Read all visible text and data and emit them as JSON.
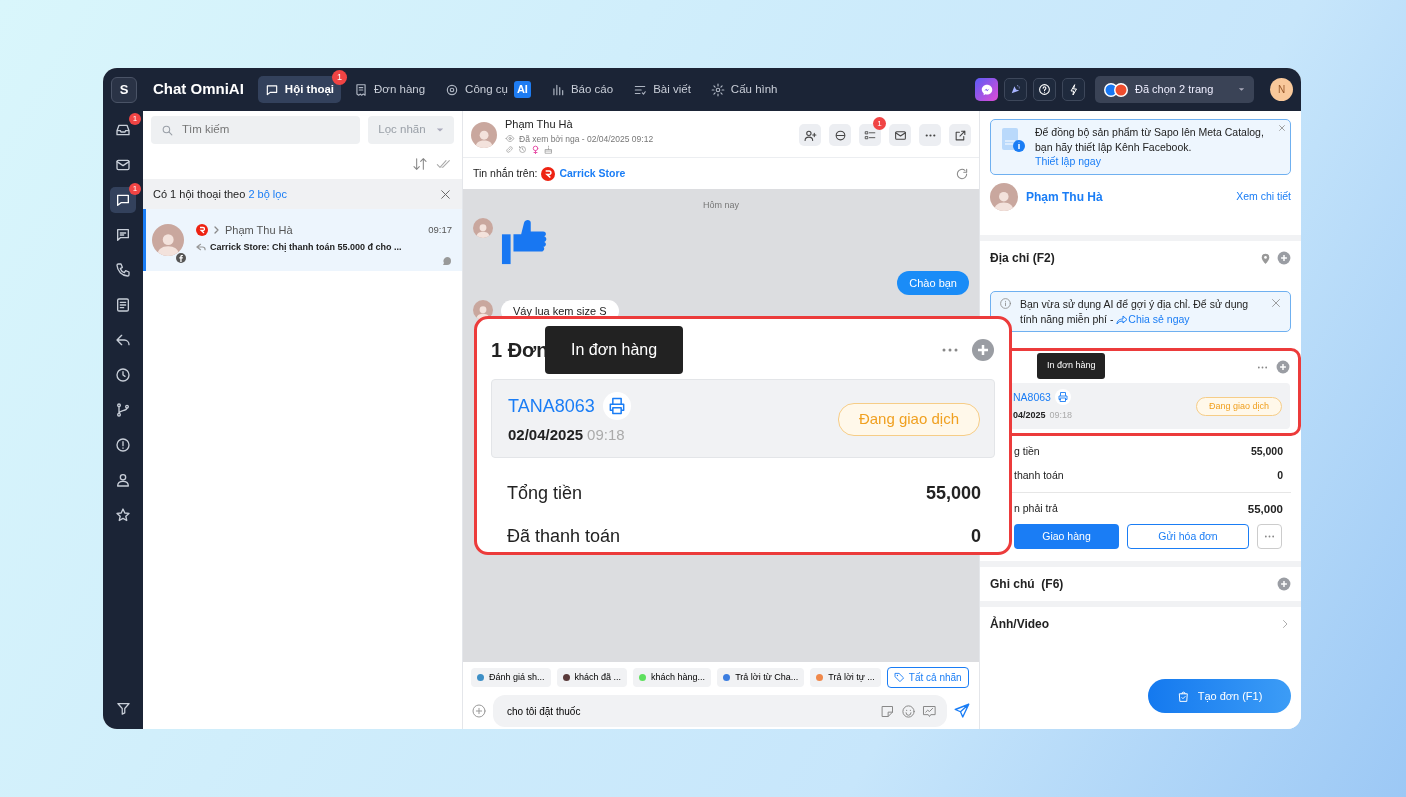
{
  "app": {
    "logo": "S",
    "title": "Chat OmniAI"
  },
  "nav": [
    {
      "label": "Hội thoại",
      "selected": true,
      "badge": "1"
    },
    {
      "label": "Đơn hàng",
      "selected": false
    },
    {
      "label": "Công cụ",
      "selected": false,
      "tag": "AI"
    },
    {
      "label": "Báo cáo",
      "selected": false
    },
    {
      "label": "Bài viết",
      "selected": false
    },
    {
      "label": "Cấu hình",
      "selected": false
    }
  ],
  "page_selector": {
    "label": "Đã chọn 2 trang"
  },
  "user": {
    "initial": "N"
  },
  "rail": [
    {
      "kind": "inbox",
      "selected": false,
      "badge": "1"
    },
    {
      "kind": "mail",
      "selected": false
    },
    {
      "kind": "chat",
      "selected": true,
      "badge": "1"
    },
    {
      "kind": "comment",
      "selected": false
    },
    {
      "kind": "phone",
      "selected": false
    },
    {
      "kind": "note",
      "selected": false
    },
    {
      "kind": "reply",
      "selected": false
    },
    {
      "kind": "clock",
      "selected": false
    },
    {
      "kind": "branch",
      "selected": false
    },
    {
      "kind": "alert",
      "selected": false
    },
    {
      "kind": "user",
      "selected": false
    },
    {
      "kind": "star",
      "selected": false
    }
  ],
  "list": {
    "search": {
      "placeholder": "Tìm kiếm"
    },
    "filter": {
      "label": "Lọc nhãn"
    },
    "filter_notice": {
      "text": "Có 1 hội thoại theo",
      "link": "2 bộ lọc"
    },
    "conversations": [
      {
        "name": "Phạm Thu Hà",
        "time": "09:17",
        "preview": "Carrick Store: Chị thanh toán 55.000 đ cho ...",
        "selected": true
      }
    ]
  },
  "chat": {
    "header": {
      "name": "Phạm Thu Hà",
      "seen": "Đã xem bởi nga - 02/04/2025 09:12",
      "task_badge": "1"
    },
    "source": {
      "label": "Tin nhắn trên:",
      "store": "Carrick Store"
    },
    "date_divider": "Hôm nay",
    "messages": [
      {
        "kind": "like"
      },
      {
        "kind": "outgoing",
        "text": "Chào bạn"
      },
      {
        "kind": "incoming",
        "text": "Váy lụa kem size S"
      }
    ],
    "tags": [
      {
        "label": "Đánh giá sh...",
        "color": "#3d8fc6"
      },
      {
        "label": "khách đã ...",
        "color": "#5a3a3a"
      },
      {
        "label": "khách hàng...",
        "color": "#5ee05e"
      },
      {
        "label": "Trả lời từ Cha...",
        "color": "#3b7de0"
      },
      {
        "label": "Trả lời tự ...",
        "color": "#f0884a"
      }
    ],
    "all_tags": "Tất cả nhãn",
    "composer": {
      "value": "cho tôi đặt thuốc"
    }
  },
  "callout": {
    "title": "1 Đơn",
    "tooltip": "In đơn hàng",
    "code": "TANA8063",
    "date": "02/04/2025",
    "time": "09:18",
    "status": "Đang giao dịch",
    "rows": [
      {
        "label": "Tổng tiền",
        "value": "55,000"
      },
      {
        "label": "Đã thanh toán",
        "value": "0"
      }
    ]
  },
  "right": {
    "notice": {
      "text": "Để đồng bộ sản phẩm từ Sapo lên Meta Catalog, bạn hãy thiết lập Kênh Facebook.",
      "link": "Thiết lập ngay"
    },
    "customer": {
      "name": "Phạm Thu Hà",
      "link": "Xem chi tiết"
    },
    "address": {
      "title": "Địa chỉ (F2)",
      "notice": "Bạn vừa sử dụng AI để gợi ý địa chỉ. Để sử dụng tính năng miễn phí -",
      "link": "Chia sẻ ngay"
    },
    "order": {
      "tooltip": "In đơn hàng",
      "code": "NA8063",
      "date": "04/2025",
      "time": "09:18",
      "status": "Đang giao dịch",
      "rows": [
        {
          "label": "g tiền",
          "value": "55,000",
          "bold": false
        },
        {
          "label": "thanh toán",
          "value": "0",
          "bold": false
        },
        {
          "label": "n phải trả",
          "value": "55,000",
          "bold": true
        }
      ],
      "buttons": [
        {
          "label": "Giao hàng",
          "kind": "primary"
        },
        {
          "label": "Gửi hóa đơn",
          "kind": "outline"
        }
      ]
    },
    "notes": {
      "title": "Ghi chú  (F6)"
    },
    "media": {
      "title": "Ảnh/Video"
    },
    "create": {
      "label": "Tạo đơn (F1)"
    }
  }
}
